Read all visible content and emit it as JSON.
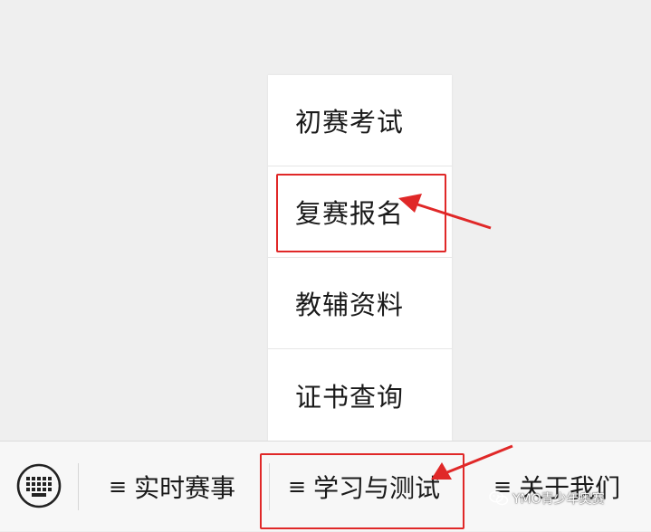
{
  "popup_menu": {
    "items": [
      {
        "label": "初赛考试"
      },
      {
        "label": "复赛报名"
      },
      {
        "label": "教辅资料"
      },
      {
        "label": "证书查询"
      }
    ]
  },
  "bottom_menu": {
    "keyboard_icon": "keyboard-icon",
    "items": [
      {
        "glyph": "≡",
        "label": "实时赛事"
      },
      {
        "glyph": "≡",
        "label": "学习与测试"
      },
      {
        "glyph": "≡",
        "label": "关于我们"
      }
    ]
  },
  "watermark": {
    "text": "YMO青少年奥赛",
    "icon": "wechat-icon"
  },
  "colors": {
    "highlight": "#e02828",
    "background": "#efefef",
    "menu_background": "#ffffff"
  }
}
